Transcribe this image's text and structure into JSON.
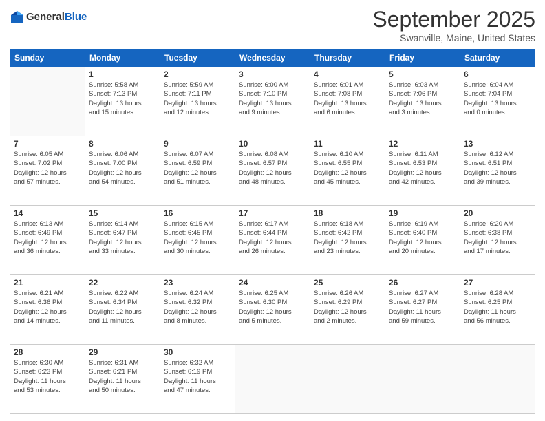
{
  "header": {
    "logo": {
      "general": "General",
      "blue": "Blue"
    },
    "title": "September 2025",
    "location": "Swanville, Maine, United States"
  },
  "weekdays": [
    "Sunday",
    "Monday",
    "Tuesday",
    "Wednesday",
    "Thursday",
    "Friday",
    "Saturday"
  ],
  "weeks": [
    [
      {
        "day": "",
        "info": ""
      },
      {
        "day": "1",
        "info": "Sunrise: 5:58 AM\nSunset: 7:13 PM\nDaylight: 13 hours\nand 15 minutes."
      },
      {
        "day": "2",
        "info": "Sunrise: 5:59 AM\nSunset: 7:11 PM\nDaylight: 13 hours\nand 12 minutes."
      },
      {
        "day": "3",
        "info": "Sunrise: 6:00 AM\nSunset: 7:10 PM\nDaylight: 13 hours\nand 9 minutes."
      },
      {
        "day": "4",
        "info": "Sunrise: 6:01 AM\nSunset: 7:08 PM\nDaylight: 13 hours\nand 6 minutes."
      },
      {
        "day": "5",
        "info": "Sunrise: 6:03 AM\nSunset: 7:06 PM\nDaylight: 13 hours\nand 3 minutes."
      },
      {
        "day": "6",
        "info": "Sunrise: 6:04 AM\nSunset: 7:04 PM\nDaylight: 13 hours\nand 0 minutes."
      }
    ],
    [
      {
        "day": "7",
        "info": "Sunrise: 6:05 AM\nSunset: 7:02 PM\nDaylight: 12 hours\nand 57 minutes."
      },
      {
        "day": "8",
        "info": "Sunrise: 6:06 AM\nSunset: 7:00 PM\nDaylight: 12 hours\nand 54 minutes."
      },
      {
        "day": "9",
        "info": "Sunrise: 6:07 AM\nSunset: 6:59 PM\nDaylight: 12 hours\nand 51 minutes."
      },
      {
        "day": "10",
        "info": "Sunrise: 6:08 AM\nSunset: 6:57 PM\nDaylight: 12 hours\nand 48 minutes."
      },
      {
        "day": "11",
        "info": "Sunrise: 6:10 AM\nSunset: 6:55 PM\nDaylight: 12 hours\nand 45 minutes."
      },
      {
        "day": "12",
        "info": "Sunrise: 6:11 AM\nSunset: 6:53 PM\nDaylight: 12 hours\nand 42 minutes."
      },
      {
        "day": "13",
        "info": "Sunrise: 6:12 AM\nSunset: 6:51 PM\nDaylight: 12 hours\nand 39 minutes."
      }
    ],
    [
      {
        "day": "14",
        "info": "Sunrise: 6:13 AM\nSunset: 6:49 PM\nDaylight: 12 hours\nand 36 minutes."
      },
      {
        "day": "15",
        "info": "Sunrise: 6:14 AM\nSunset: 6:47 PM\nDaylight: 12 hours\nand 33 minutes."
      },
      {
        "day": "16",
        "info": "Sunrise: 6:15 AM\nSunset: 6:45 PM\nDaylight: 12 hours\nand 30 minutes."
      },
      {
        "day": "17",
        "info": "Sunrise: 6:17 AM\nSunset: 6:44 PM\nDaylight: 12 hours\nand 26 minutes."
      },
      {
        "day": "18",
        "info": "Sunrise: 6:18 AM\nSunset: 6:42 PM\nDaylight: 12 hours\nand 23 minutes."
      },
      {
        "day": "19",
        "info": "Sunrise: 6:19 AM\nSunset: 6:40 PM\nDaylight: 12 hours\nand 20 minutes."
      },
      {
        "day": "20",
        "info": "Sunrise: 6:20 AM\nSunset: 6:38 PM\nDaylight: 12 hours\nand 17 minutes."
      }
    ],
    [
      {
        "day": "21",
        "info": "Sunrise: 6:21 AM\nSunset: 6:36 PM\nDaylight: 12 hours\nand 14 minutes."
      },
      {
        "day": "22",
        "info": "Sunrise: 6:22 AM\nSunset: 6:34 PM\nDaylight: 12 hours\nand 11 minutes."
      },
      {
        "day": "23",
        "info": "Sunrise: 6:24 AM\nSunset: 6:32 PM\nDaylight: 12 hours\nand 8 minutes."
      },
      {
        "day": "24",
        "info": "Sunrise: 6:25 AM\nSunset: 6:30 PM\nDaylight: 12 hours\nand 5 minutes."
      },
      {
        "day": "25",
        "info": "Sunrise: 6:26 AM\nSunset: 6:29 PM\nDaylight: 12 hours\nand 2 minutes."
      },
      {
        "day": "26",
        "info": "Sunrise: 6:27 AM\nSunset: 6:27 PM\nDaylight: 11 hours\nand 59 minutes."
      },
      {
        "day": "27",
        "info": "Sunrise: 6:28 AM\nSunset: 6:25 PM\nDaylight: 11 hours\nand 56 minutes."
      }
    ],
    [
      {
        "day": "28",
        "info": "Sunrise: 6:30 AM\nSunset: 6:23 PM\nDaylight: 11 hours\nand 53 minutes."
      },
      {
        "day": "29",
        "info": "Sunrise: 6:31 AM\nSunset: 6:21 PM\nDaylight: 11 hours\nand 50 minutes."
      },
      {
        "day": "30",
        "info": "Sunrise: 6:32 AM\nSunset: 6:19 PM\nDaylight: 11 hours\nand 47 minutes."
      },
      {
        "day": "",
        "info": ""
      },
      {
        "day": "",
        "info": ""
      },
      {
        "day": "",
        "info": ""
      },
      {
        "day": "",
        "info": ""
      }
    ]
  ]
}
